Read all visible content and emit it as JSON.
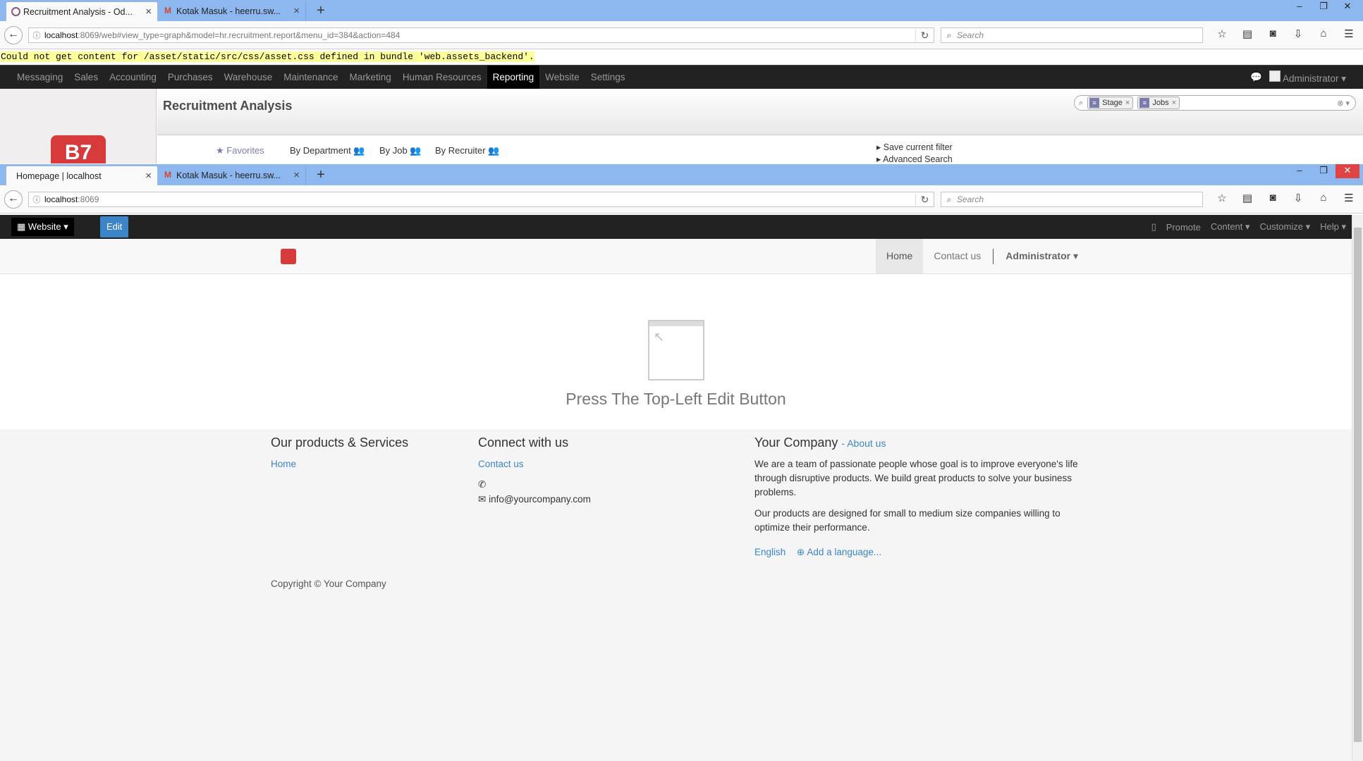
{
  "top_window": {
    "tabs": [
      {
        "title": "Recruitment Analysis - Od...",
        "active": true
      },
      {
        "title": "Kotak Masuk - heerru.sw...",
        "active": false
      }
    ],
    "url_host": "localhost",
    "url_rest": ":8069/web#view_type=graph&model=hr.recruitment.report&menu_id=384&action=484",
    "search_placeholder": "Search",
    "error_message": "Could not get content for /asset/static/src/css/asset.css defined in bundle 'web.assets_backend'.",
    "menu": [
      "Messaging",
      "Sales",
      "Accounting",
      "Purchases",
      "Warehouse",
      "Maintenance",
      "Marketing",
      "Human Resources",
      "Reporting",
      "Website",
      "Settings"
    ],
    "active_menu": "Reporting",
    "user": "Administrator",
    "page_title": "Recruitment Analysis",
    "facets": [
      "Stage",
      "Jobs"
    ],
    "filters": {
      "favorites": "Favorites",
      "groups": [
        "By Department",
        "By Job",
        "By Recruiter"
      ],
      "save_filter": "Save current filter",
      "advanced_search": "Advanced Search"
    }
  },
  "bottom_window": {
    "tabs": [
      {
        "title": "Homepage | localhost",
        "active": true
      },
      {
        "title": "Kotak Masuk - heerru.sw...",
        "active": false
      }
    ],
    "url_host": "localhost",
    "url_rest": ":8069",
    "search_placeholder": "Search",
    "website_menu": "Website",
    "edit_label": "Edit",
    "right_menu": [
      "Promote",
      "Content",
      "Customize",
      "Help"
    ],
    "nav": {
      "home": "Home",
      "contact": "Contact us",
      "admin": "Administrator"
    },
    "press_text": "Press The Top-Left Edit Button",
    "footer": {
      "products_title": "Our products & Services",
      "products_link": "Home",
      "connect_title": "Connect with us",
      "connect_link": "Contact us",
      "email": "info@yourcompany.com",
      "company_title": "Your Company",
      "about_link": "- About us",
      "para1": "We are a team of passionate people whose goal is to improve everyone's life through disruptive products. We build great products to solve your business problems.",
      "para2": "Our products are designed for small to medium size companies willing to optimize their performance.",
      "lang": "English",
      "add_lang": "Add a language...",
      "copyright": "Copyright © Your Company"
    }
  },
  "colors": {
    "tabstrip": "#8db7ef",
    "odoo_bar": "#222222",
    "accent": "#3c85c8",
    "odoo_purple": "#7c7bad"
  }
}
